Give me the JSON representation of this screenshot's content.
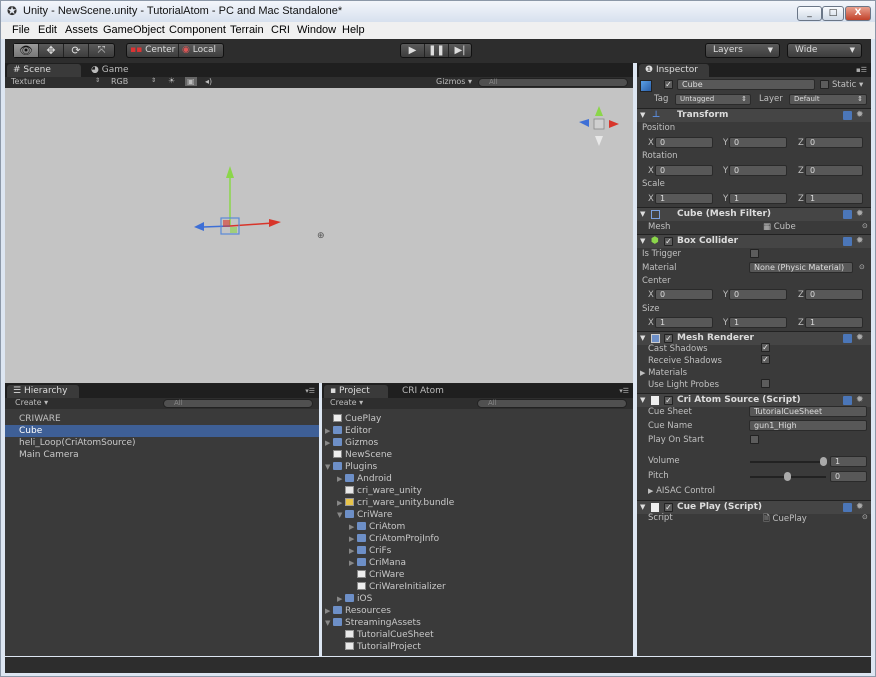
{
  "window": {
    "title": "Unity - NewScene.unity - TutorialAtom - PC and Mac Standalone*",
    "min_label": "_",
    "max_label": "□",
    "close_label": "X"
  },
  "menu": [
    "File",
    "Edit",
    "Assets",
    "GameObject",
    "Component",
    "Terrain",
    "CRI",
    "Window",
    "Help"
  ],
  "toolbar": {
    "pivot_label": "Center",
    "space_label": "Local",
    "layers_label": "Layers",
    "layout_label": "Wide"
  },
  "scene": {
    "tab_scene": "Scene",
    "tab_game": "Game",
    "shading": "Textured",
    "render_mode": "RGB",
    "gizmos": "Gizmos",
    "search_placeholder": "All"
  },
  "hierarchy": {
    "tab": "Hierarchy",
    "create": "Create",
    "search_placeholder": "All",
    "items": [
      "CRIWARE",
      "Cube",
      "heli_Loop(CriAtomSource)",
      "Main Camera"
    ]
  },
  "project": {
    "tab": "Project",
    "tab2": "CRI Atom",
    "create": "Create",
    "search_placeholder": "All",
    "items": [
      {
        "label": "CuePlay",
        "depth": 0,
        "type": "script",
        "arrow": ""
      },
      {
        "label": "Editor",
        "depth": 0,
        "type": "folder",
        "arrow": "▶"
      },
      {
        "label": "Gizmos",
        "depth": 0,
        "type": "folder",
        "arrow": "▶"
      },
      {
        "label": "NewScene",
        "depth": 0,
        "type": "scene",
        "arrow": ""
      },
      {
        "label": "Plugins",
        "depth": 0,
        "type": "folder",
        "arrow": "▼"
      },
      {
        "label": "Android",
        "depth": 1,
        "type": "folder",
        "arrow": "▶"
      },
      {
        "label": "cri_ware_unity",
        "depth": 1,
        "type": "file",
        "arrow": ""
      },
      {
        "label": "cri_ware_unity.bundle",
        "depth": 1,
        "type": "bundle",
        "arrow": "▶"
      },
      {
        "label": "CriWare",
        "depth": 1,
        "type": "folder",
        "arrow": "▼"
      },
      {
        "label": "CriAtom",
        "depth": 2,
        "type": "folder",
        "arrow": "▶"
      },
      {
        "label": "CriAtomProjInfo",
        "depth": 2,
        "type": "folder",
        "arrow": "▶"
      },
      {
        "label": "CriFs",
        "depth": 2,
        "type": "folder",
        "arrow": "▶"
      },
      {
        "label": "CriMana",
        "depth": 2,
        "type": "folder",
        "arrow": "▶"
      },
      {
        "label": "CriWare",
        "depth": 2,
        "type": "script",
        "arrow": ""
      },
      {
        "label": "CriWareInitializer",
        "depth": 2,
        "type": "script",
        "arrow": ""
      },
      {
        "label": "iOS",
        "depth": 1,
        "type": "folder",
        "arrow": "▶"
      },
      {
        "label": "Resources",
        "depth": 0,
        "type": "folder",
        "arrow": "▶"
      },
      {
        "label": "StreamingAssets",
        "depth": 0,
        "type": "folder",
        "arrow": "▼"
      },
      {
        "label": "TutorialCueSheet",
        "depth": 1,
        "type": "file",
        "arrow": ""
      },
      {
        "label": "TutorialProject",
        "depth": 1,
        "type": "file",
        "arrow": ""
      }
    ]
  },
  "inspector": {
    "tab": "Inspector",
    "object_name": "Cube",
    "static_label": "Static",
    "tag_label": "Tag",
    "tag_value": "Untagged",
    "layer_label": "Layer",
    "layer_value": "Default",
    "transform": {
      "title": "Transform",
      "position_label": "Position",
      "rotation_label": "Rotation",
      "scale_label": "Scale",
      "axis_x": "X",
      "axis_y": "Y",
      "axis_z": "Z",
      "position": [
        "0",
        "0",
        "0"
      ],
      "rotation": [
        "0",
        "0",
        "0"
      ],
      "scale": [
        "1",
        "1",
        "1"
      ]
    },
    "mesh_filter": {
      "title": "Cube (Mesh Filter)",
      "mesh_label": "Mesh",
      "mesh_value": "Cube"
    },
    "box_collider": {
      "title": "Box Collider",
      "is_trigger_label": "Is Trigger",
      "material_label": "Material",
      "material_value": "None (Physic Material)",
      "center_label": "Center",
      "size_label": "Size",
      "center": [
        "0",
        "0",
        "0"
      ],
      "size": [
        "1",
        "1",
        "1"
      ]
    },
    "mesh_renderer": {
      "title": "Mesh Renderer",
      "cast_shadows": "Cast Shadows",
      "receive_shadows": "Receive Shadows",
      "materials": "Materials",
      "use_light_probes": "Use Light Probes"
    },
    "cri_atom_source": {
      "title": "Cri Atom Source (Script)",
      "cue_sheet_label": "Cue Sheet",
      "cue_sheet_value": "TutorialCueSheet",
      "cue_name_label": "Cue Name",
      "cue_name_value": "gun1_High",
      "play_on_start_label": "Play On Start",
      "volume_label": "Volume",
      "volume_value": "1",
      "pitch_label": "Pitch",
      "pitch_value": "0",
      "aisac_label": "AISAC Control"
    },
    "cue_play": {
      "title": "Cue Play (Script)",
      "script_label": "Script",
      "script_value": "CuePlay"
    }
  },
  "colors": {
    "selection": "#3e5f96",
    "scene_bg": "#c4c4c4",
    "panel_bg": "#3a3a3a",
    "x_axis": "#d8352a",
    "y_axis": "#8bd64a",
    "z_axis": "#3e6fd6"
  }
}
